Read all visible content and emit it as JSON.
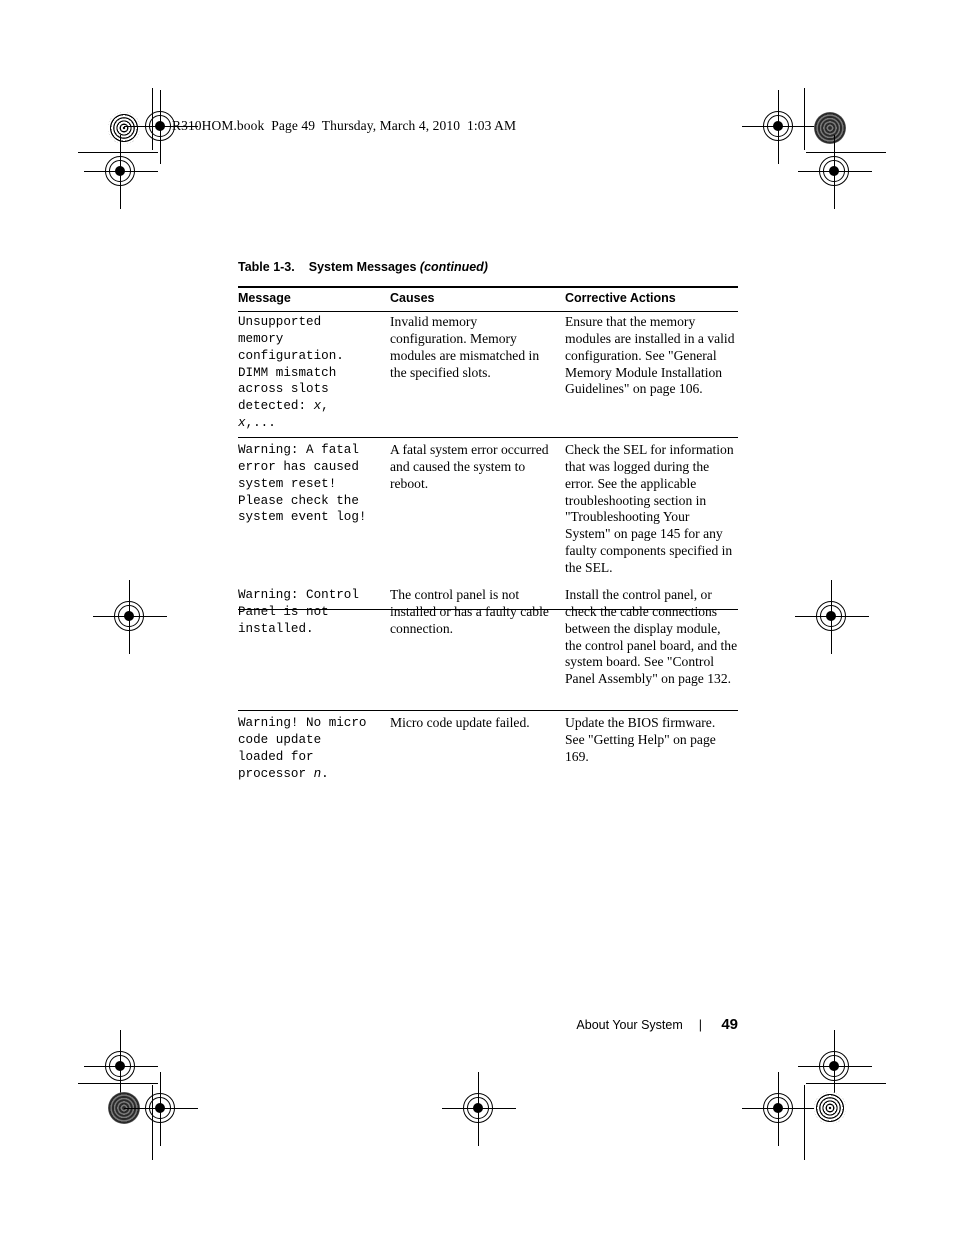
{
  "print_header": {
    "text": "R310HOM.book  Page 49  Thursday, March 4, 2010  1:03 AM"
  },
  "table": {
    "caption_label": "Table 1-3.",
    "caption_title": "System Messages",
    "caption_continued": "(continued)",
    "headers": [
      "Message",
      "Causes",
      "Corrective Actions"
    ],
    "rows": [
      {
        "message": "Unsupported memory configuration. DIMM mismatch across slots detected: x, x,...",
        "message_lines": [
          "Unsupported",
          "memory",
          "configuration.",
          "DIMM mismatch",
          "across slots",
          "detected: x,",
          "x,..."
        ],
        "causes": "Invalid memory configuration. Memory modules are mismatched in the specified slots.",
        "corrective_actions": "Ensure that the memory modules are installed in a valid configuration. See \"General Memory Module Installation Guidelines\" on page 106."
      },
      {
        "message": "Warning: A fatal error has caused system reset! Please check the system event log!",
        "message_lines": [
          "Warning: A fatal",
          "error has caused",
          "system reset!",
          "Please check the",
          "system event log!"
        ],
        "causes": "A fatal system error occurred and caused the system to reboot.",
        "corrective_actions": "Check the SEL for information that was logged during the error. See the applicable troubleshooting section in \"Troubleshooting Your System\" on page 145 for any faulty components specified in the SEL."
      },
      {
        "message": "Warning: Control Panel is not installed.",
        "message_lines": [
          "Warning: Control",
          "Panel is not",
          "installed."
        ],
        "causes": "The control panel is not installed or has a faulty cable connection.",
        "corrective_actions": "Install the control panel, or check the cable connections between the display module, the control panel board, and the system board. See \"Control Panel Assembly\" on page 132."
      },
      {
        "message": "Warning! No micro code update loaded for processor n.",
        "message_lines": [
          "Warning! No micro",
          "code update",
          "loaded for",
          "processor n."
        ],
        "causes": "Micro code update failed.",
        "corrective_actions": "Update the BIOS firmware. See \"Getting Help\" on page 169."
      }
    ]
  },
  "footer": {
    "section": "About Your System",
    "separator": "|",
    "page_number": "49"
  },
  "colors": {
    "text": "#000000",
    "background": "#ffffff",
    "rule": "#000000"
  }
}
